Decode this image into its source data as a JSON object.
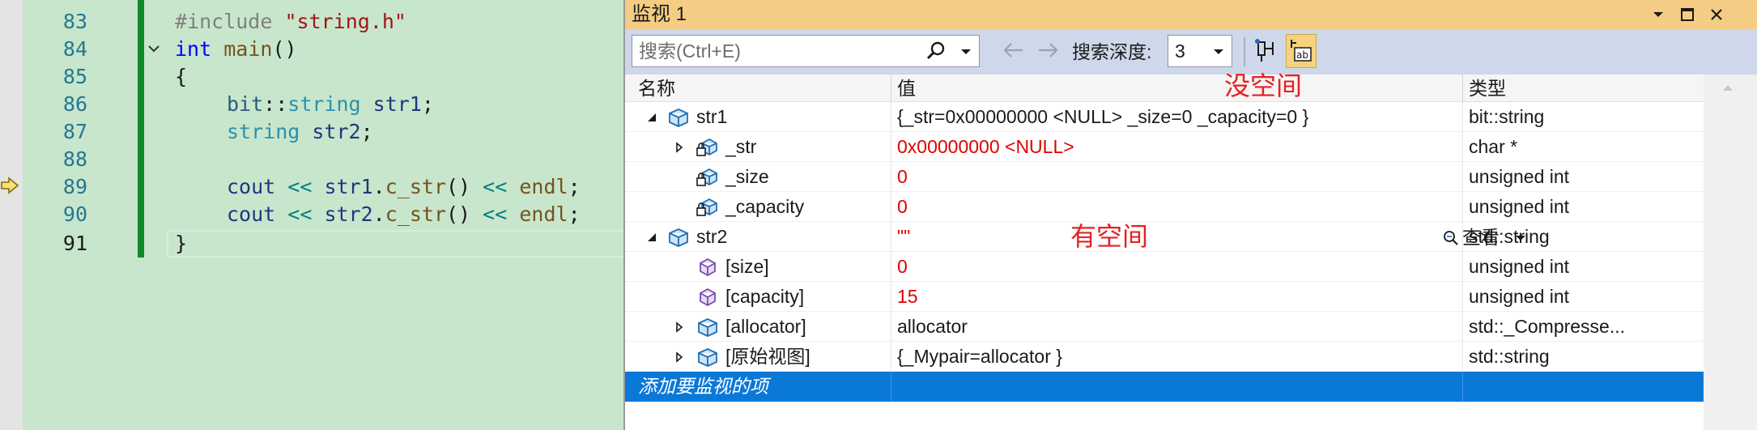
{
  "editor": {
    "lines": [
      {
        "num": "83",
        "current": false
      },
      {
        "num": "84",
        "current": false
      },
      {
        "num": "85",
        "current": false
      },
      {
        "num": "86",
        "current": false
      },
      {
        "num": "87",
        "current": false
      },
      {
        "num": "88",
        "current": false
      },
      {
        "num": "89",
        "current": false
      },
      {
        "num": "90",
        "current": false
      },
      {
        "num": "91",
        "current": true
      }
    ],
    "code": {
      "l83_pp": "#include ",
      "l83_str": "\"string.h\"",
      "l84_kw": "int",
      "l84_fn": "main",
      "l84_rest": "()",
      "l85": "{",
      "l86_ns": "bit",
      "l86_sep": "::",
      "l86_ty": "string",
      "l86_var": "str1",
      "l86_end": ";",
      "l87_ty": "string",
      "l87_var": "str2",
      "l87_end": ";",
      "l89_cout": "cout",
      "l89_op1": "<<",
      "l89_var": "str1",
      "l89_dot": ".",
      "l89_fn": "c_str",
      "l89_paren": "()",
      "l89_op2": "<<",
      "l89_endl": "endl",
      "l89_end": ";",
      "l90_cout": "cout",
      "l90_op1": "<<",
      "l90_var": "str2",
      "l90_dot": ".",
      "l90_fn": "c_str",
      "l90_paren": "()",
      "l90_op2": "<<",
      "l90_endl": "endl",
      "l90_end": ";",
      "l91": "}"
    }
  },
  "watch": {
    "title": "监视 1",
    "search_placeholder": "搜索(Ctrl+E)",
    "depth_label": "搜索深度:",
    "depth_value": "3",
    "columns": {
      "name": "名称",
      "value": "值",
      "type": "类型"
    },
    "rows": [
      {
        "name": "str1",
        "value": "{_str=0x00000000 <NULL> _size=0 _capacity=0 }",
        "type": "bit::string",
        "red": false
      },
      {
        "name": "_str",
        "value": "0x00000000 <NULL>",
        "type": "char *",
        "red": true
      },
      {
        "name": "_size",
        "value": "0",
        "type": "unsigned int",
        "red": true
      },
      {
        "name": "_capacity",
        "value": "0",
        "type": "unsigned int",
        "red": true
      },
      {
        "name": "str2",
        "value": "\"\"",
        "type": "std::string",
        "red": true
      },
      {
        "name": "[size]",
        "value": "0",
        "type": "unsigned int",
        "red": true
      },
      {
        "name": "[capacity]",
        "value": "15",
        "type": "unsigned int",
        "red": true
      },
      {
        "name": "[allocator]",
        "value": "allocator",
        "type": "std::_Compresse...",
        "red": false
      },
      {
        "name": "[原始视图]",
        "value": "{_Mypair=allocator }",
        "type": "std::string",
        "red": false
      }
    ],
    "add_item": "添加要监视的项",
    "view_label": "查看",
    "annotations": {
      "no_space": "没空间",
      "has_space": "有空间"
    },
    "colors": {
      "title_bg": "#f5cc84",
      "selection": "#0a78d7",
      "changed_value": "#e00000"
    }
  }
}
